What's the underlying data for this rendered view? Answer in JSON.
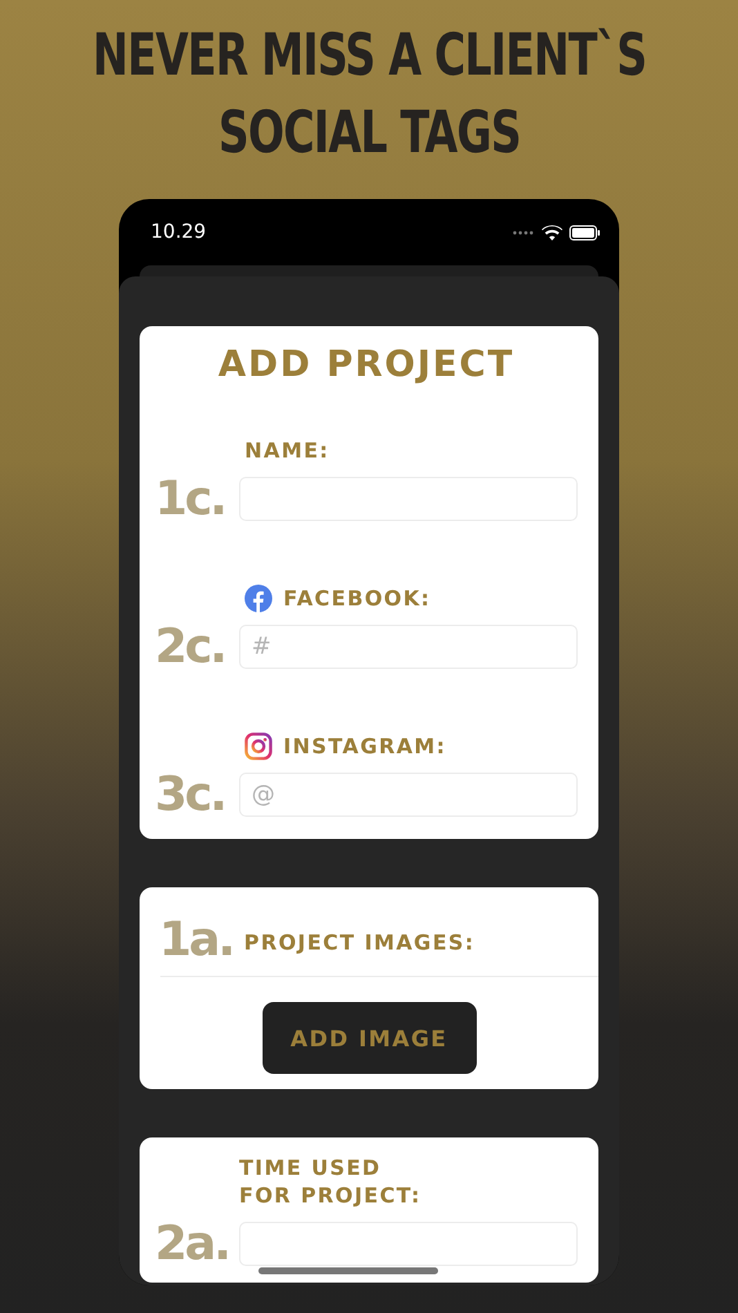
{
  "headline": [
    "NEVER MISS A CLIENT`S",
    "SOCIAL TAGS"
  ],
  "status_bar": {
    "time": "10.29"
  },
  "add_project": {
    "title": "ADD PROJECT",
    "fields": [
      {
        "step": "1c.",
        "label": "NAME:",
        "kind": "plain"
      },
      {
        "step": "2c.",
        "label": "FACEBOOK:",
        "kind": "facebook",
        "placeholder": "#"
      },
      {
        "step": "3c.",
        "label": "INSTAGRAM:",
        "kind": "instagram",
        "placeholder": "@"
      }
    ]
  },
  "images": {
    "step": "1a.",
    "label": "PROJECT IMAGES:",
    "button": "ADD IMAGE"
  },
  "time": {
    "step": "2a.",
    "label": "TIME USED\nFOR PROJECT:"
  }
}
